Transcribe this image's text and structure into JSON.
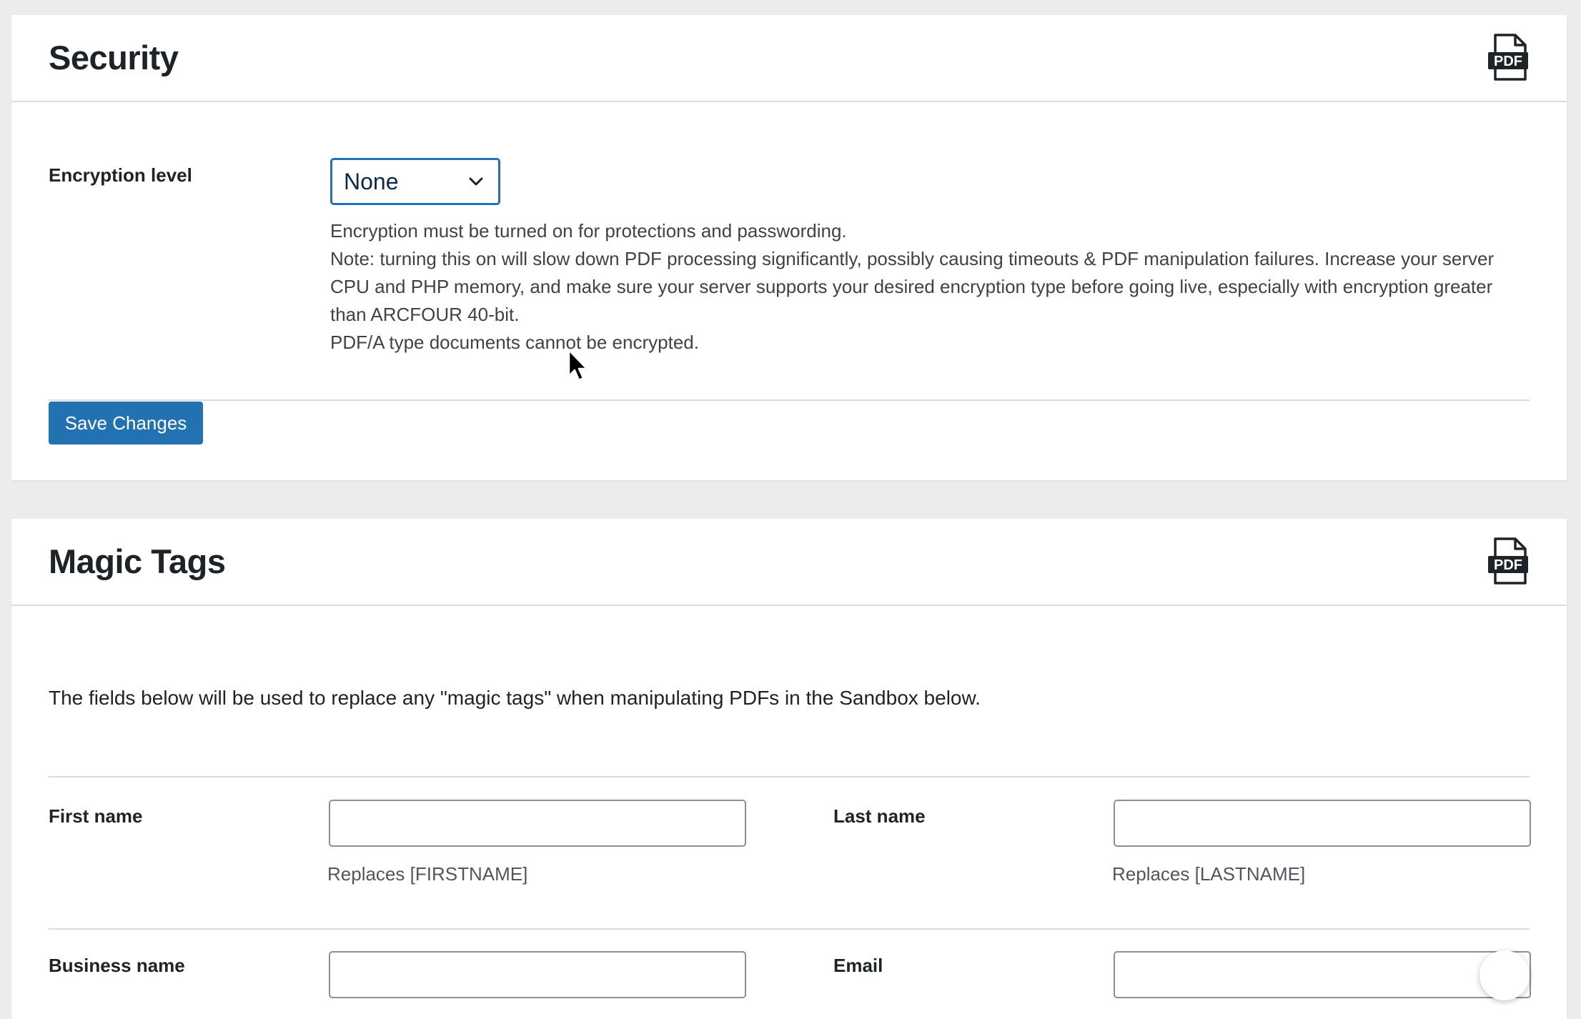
{
  "security": {
    "title": "Security",
    "encryption_label": "Encryption level",
    "encryption_value": "None",
    "description": [
      "Encryption must be turned on for protections and passwording.",
      "Note: turning this on will slow down PDF processing significantly, possibly causing timeouts & PDF manipulation failures. Increase your server CPU and PHP memory, and make sure your server supports your desired encryption type before going live, especially with encryption greater than ARCFOUR 40-bit.",
      "PDF/A type documents cannot be encrypted."
    ],
    "save_label": "Save Changes"
  },
  "magic_tags": {
    "title": "Magic Tags",
    "intro": "The fields below will be used to replace any \"magic tags\" when manipulating PDFs in the Sandbox below.",
    "first_name_label": "First name",
    "first_name_value": "",
    "first_name_hint": "Replaces [FIRSTNAME]",
    "last_name_label": "Last name",
    "last_name_value": "",
    "last_name_hint": "Replaces [LASTNAME]",
    "business_name_label": "Business name",
    "email_label": "Email"
  },
  "icons": {
    "pdf": "pdf-file-icon",
    "dropdown": "chevron-down-icon",
    "cursor": "mouse-pointer-icon"
  },
  "colors": {
    "accent": "#2271b1",
    "background": "#ececec",
    "card": "#ffffff"
  }
}
